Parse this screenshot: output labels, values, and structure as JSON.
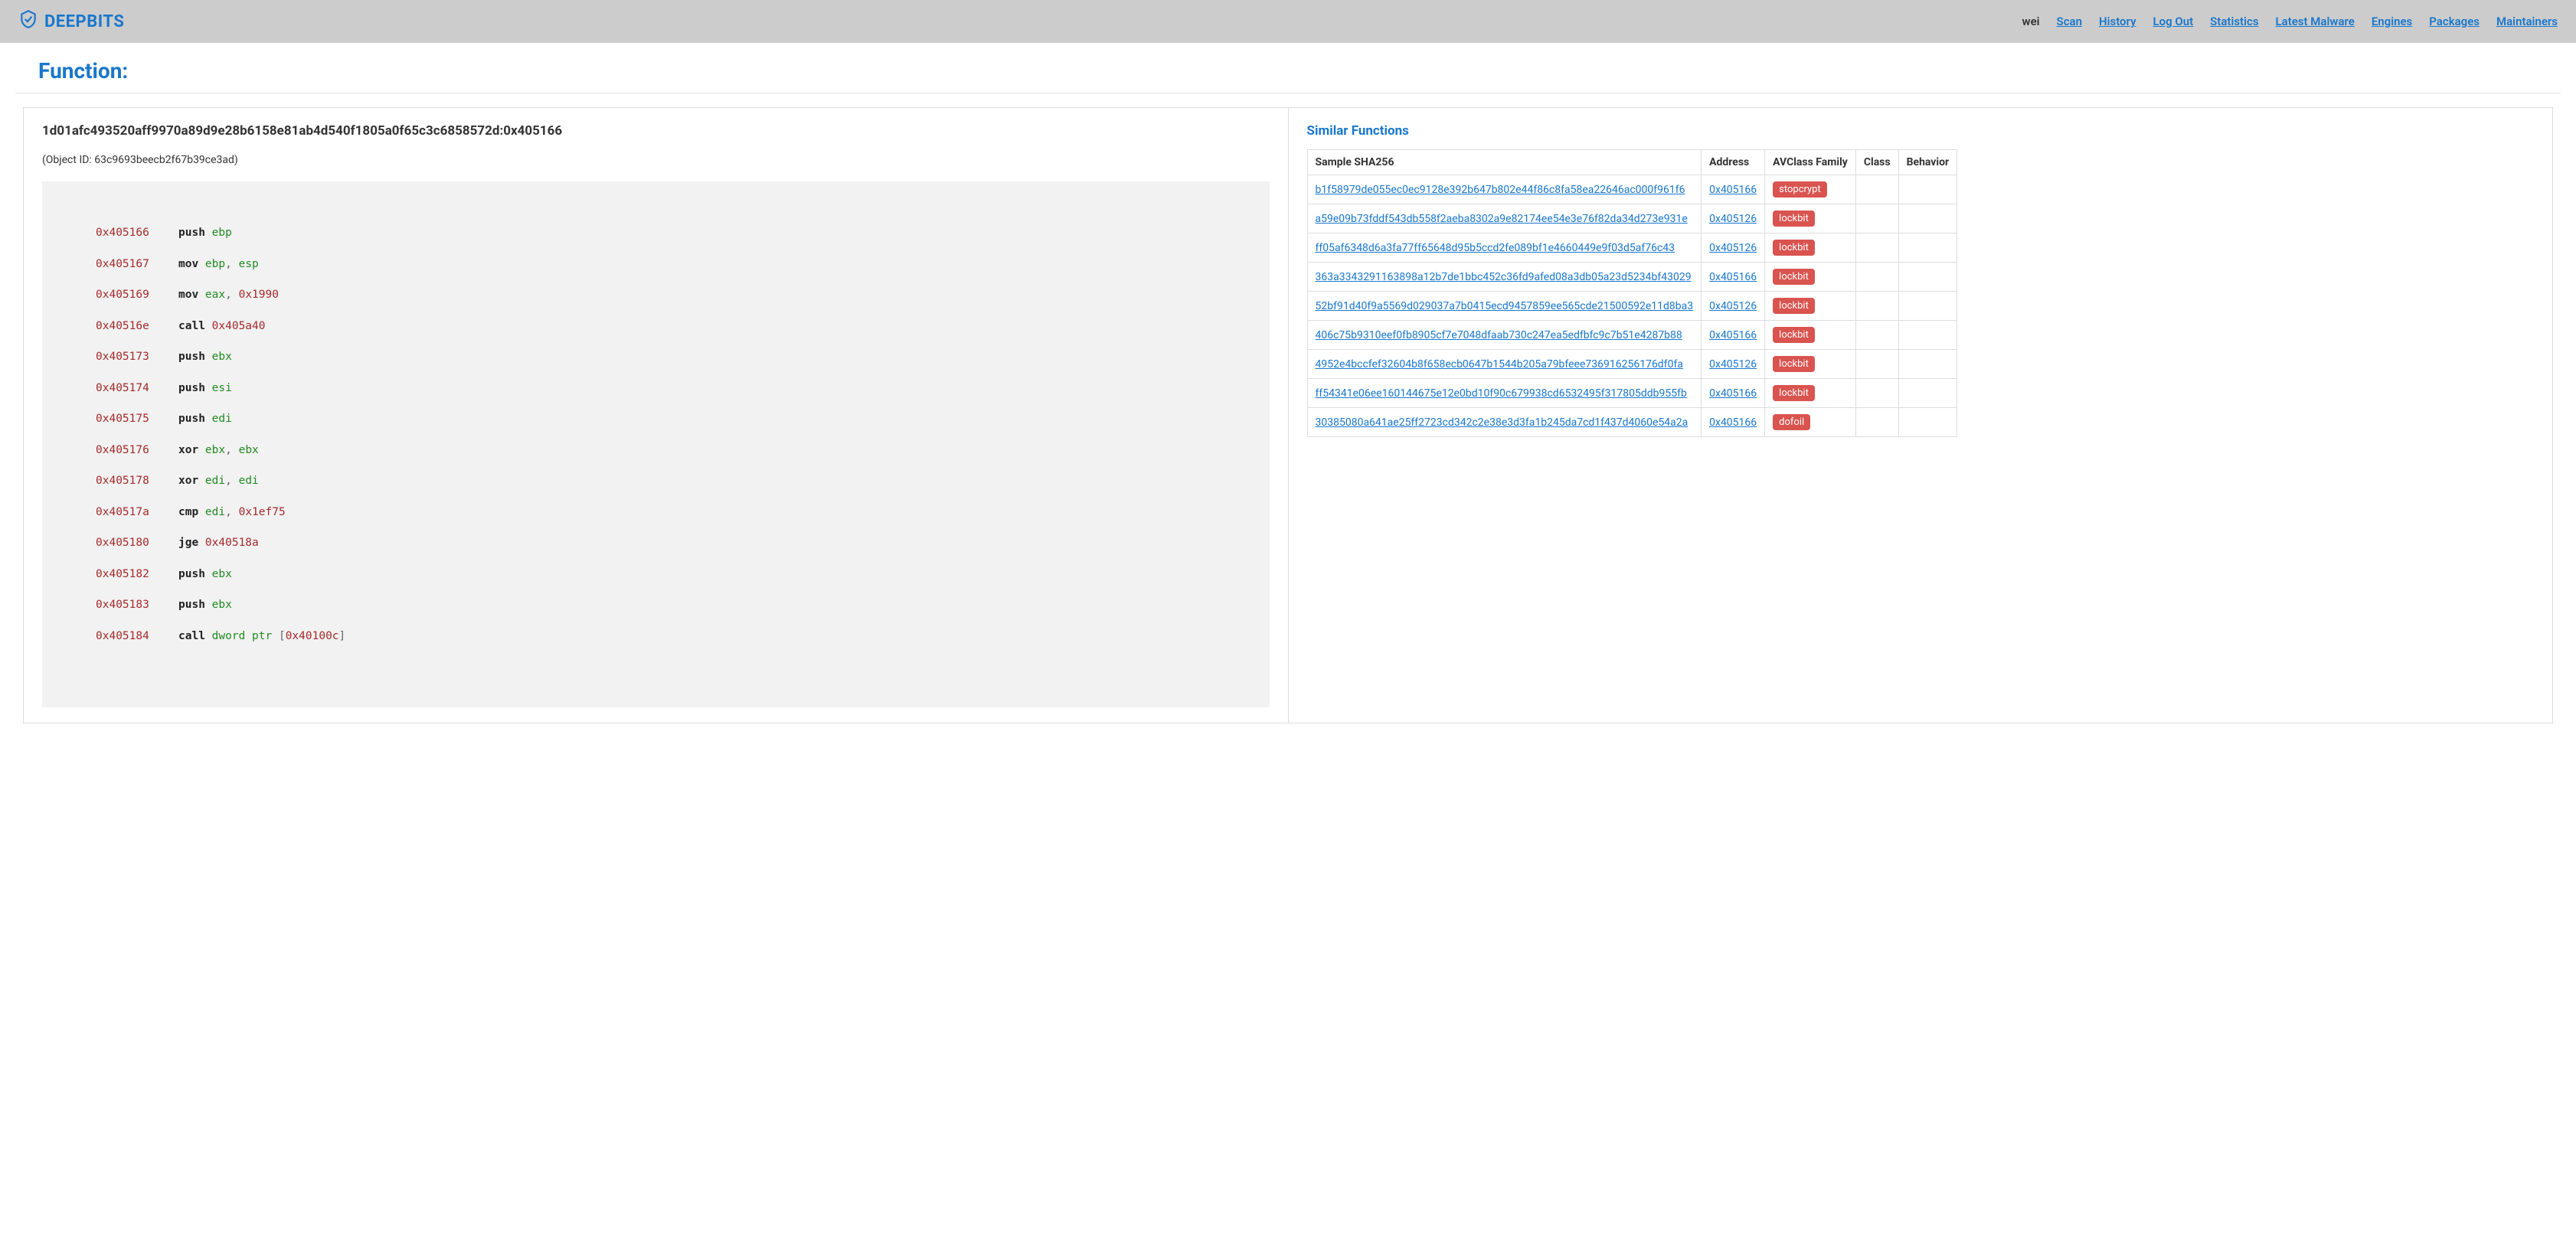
{
  "brand": "DEEPBITS",
  "user": "wei",
  "nav": [
    "Scan",
    "History",
    "Log Out",
    "Statistics",
    "Latest Malware",
    "Engines",
    "Packages",
    "Maintainers"
  ],
  "page_title": "Function:",
  "function": {
    "hash": "1d01afc493520aff9970a89d9e28b6158e81ab4d540f1805a0f65c3c6858572d:0x405166",
    "object_id": "(Object ID: 63c9693beecb2f67b39ce3ad)"
  },
  "asm": [
    {
      "addr": "0x405166",
      "mnemonic": "push",
      "ops": [
        {
          "t": "reg",
          "v": "ebp"
        }
      ]
    },
    {
      "addr": "0x405167",
      "mnemonic": "mov",
      "ops": [
        {
          "t": "reg",
          "v": "ebp"
        },
        {
          "t": "punct",
          "v": ", "
        },
        {
          "t": "reg",
          "v": "esp"
        }
      ]
    },
    {
      "addr": "0x405169",
      "mnemonic": "mov",
      "ops": [
        {
          "t": "reg",
          "v": "eax"
        },
        {
          "t": "punct",
          "v": ", "
        },
        {
          "t": "imm",
          "v": "0x1990"
        }
      ]
    },
    {
      "addr": "0x40516e",
      "mnemonic": "call",
      "ops": [
        {
          "t": "imm",
          "v": "0x405a40"
        }
      ]
    },
    {
      "addr": "0x405173",
      "mnemonic": "push",
      "ops": [
        {
          "t": "reg",
          "v": "ebx"
        }
      ]
    },
    {
      "addr": "0x405174",
      "mnemonic": "push",
      "ops": [
        {
          "t": "reg",
          "v": "esi"
        }
      ]
    },
    {
      "addr": "0x405175",
      "mnemonic": "push",
      "ops": [
        {
          "t": "reg",
          "v": "edi"
        }
      ]
    },
    {
      "addr": "0x405176",
      "mnemonic": "xor",
      "ops": [
        {
          "t": "reg",
          "v": "ebx"
        },
        {
          "t": "punct",
          "v": ", "
        },
        {
          "t": "reg",
          "v": "ebx"
        }
      ]
    },
    {
      "addr": "0x405178",
      "mnemonic": "xor",
      "ops": [
        {
          "t": "reg",
          "v": "edi"
        },
        {
          "t": "punct",
          "v": ", "
        },
        {
          "t": "reg",
          "v": "edi"
        }
      ]
    },
    {
      "addr": "0x40517a",
      "mnemonic": "cmp",
      "ops": [
        {
          "t": "reg",
          "v": "edi"
        },
        {
          "t": "punct",
          "v": ", "
        },
        {
          "t": "imm",
          "v": "0x1ef75"
        }
      ]
    },
    {
      "addr": "0x405180",
      "mnemonic": "jge",
      "ops": [
        {
          "t": "imm",
          "v": "0x40518a"
        }
      ]
    },
    {
      "addr": "0x405182",
      "mnemonic": "push",
      "ops": [
        {
          "t": "reg",
          "v": "ebx"
        }
      ]
    },
    {
      "addr": "0x405183",
      "mnemonic": "push",
      "ops": [
        {
          "t": "reg",
          "v": "ebx"
        }
      ]
    },
    {
      "addr": "0x405184",
      "mnemonic": "call",
      "ops": [
        {
          "t": "mem",
          "v": "dword ptr "
        },
        {
          "t": "punct",
          "v": "["
        },
        {
          "t": "imm",
          "v": "0x40100c"
        },
        {
          "t": "punct",
          "v": "]"
        }
      ]
    }
  ],
  "similar": {
    "title": "Similar Functions",
    "headers": [
      "Sample SHA256",
      "Address",
      "AVClass Family",
      "Class",
      "Behavior"
    ],
    "rows": [
      {
        "sha": "b1f58979de055ec0ec9128e392b647b802e44f86c8fa58ea22646ac000f961f6",
        "addr": "0x405166",
        "family": "stopcrypt",
        "class": "",
        "behavior": ""
      },
      {
        "sha": "a59e09b73fddf543db558f2aeba8302a9e82174ee54e3e76f82da34d273e931e",
        "addr": "0x405126",
        "family": "lockbit",
        "class": "",
        "behavior": ""
      },
      {
        "sha": "ff05af6348d6a3fa77ff65648d95b5ccd2fe089bf1e4660449e9f03d5af76c43",
        "addr": "0x405126",
        "family": "lockbit",
        "class": "",
        "behavior": ""
      },
      {
        "sha": "363a3343291163898a12b7de1bbc452c36fd9afed08a3db05a23d5234bf43029",
        "addr": "0x405166",
        "family": "lockbit",
        "class": "",
        "behavior": ""
      },
      {
        "sha": "52bf91d40f9a5569d029037a7b0415ecd9457859ee565cde21500592e11d8ba3",
        "addr": "0x405126",
        "family": "lockbit",
        "class": "",
        "behavior": ""
      },
      {
        "sha": "406c75b9310eef0fb8905cf7e7048dfaab730c247ea5edfbfc9c7b51e4287b88",
        "addr": "0x405166",
        "family": "lockbit",
        "class": "",
        "behavior": ""
      },
      {
        "sha": "4952e4bccfef32604b8f658ecb0647b1544b205a79bfeee736916256176df0fa",
        "addr": "0x405126",
        "family": "lockbit",
        "class": "",
        "behavior": ""
      },
      {
        "sha": "ff54341e06ee160144675e12e0bd10f90c679938cd6532495f317805ddb955fb",
        "addr": "0x405166",
        "family": "lockbit",
        "class": "",
        "behavior": ""
      },
      {
        "sha": "30385080a641ae25ff2723cd342c2e38e3d3fa1b245da7cd1f437d4060e54a2a",
        "addr": "0x405166",
        "family": "dofoil",
        "class": "",
        "behavior": ""
      }
    ]
  }
}
